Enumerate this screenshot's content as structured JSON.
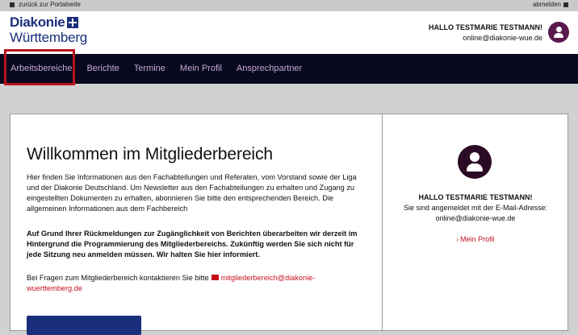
{
  "topbar": {
    "back_label": "zurück zur Portalseite",
    "logout_label": "abmelden"
  },
  "header": {
    "brand_line1": "Diakonie",
    "brand_line2": "Württemberg",
    "user_greeting": "HALLO TESTMARIE TESTMANN!",
    "user_email": "online@diakonie-wue.de"
  },
  "nav": {
    "items": [
      {
        "label": "Arbeitsbereiche"
      },
      {
        "label": "Berichte"
      },
      {
        "label": "Termine"
      },
      {
        "label": "Mein Profil"
      },
      {
        "label": "Ansprechpartner"
      }
    ]
  },
  "main": {
    "title": "Willkommen im Mitgliederbereich",
    "intro": "Hier finden Sie Informationen aus den Fachabteilungen und Referaten, vom Vorstand sowie der Liga und der Diakonie Deutschland. Um Newsletter aus den Fachabteilungen zu erhalten und Zugang zu eingestellten Dokumenten zu erhalten, abonnieren Sie bitte den entsprechenden Bereich. Die allgemeinen Informationen aus dem Fachbereich",
    "notice": "Auf Grund Ihrer Rückmeldungen zur Zugänglichkeit von Berichten überarbeiten wir derzeit im Hintergrund die Programmierung des Mitgliederbereichs. Zukünftig werden Sie sich nicht für jede Sitzung neu anmelden müssen. Wir halten Sie hier informiert.",
    "contact_prefix": "Bei Fragen zum Mitgliederbereich kontaktieren Sie bitte",
    "contact_email": "mitgliederbereich@diakonie-wuerttemberg.de"
  },
  "side": {
    "greeting": "HALLO TESTMARIE TESTMANN!",
    "logged_in_text": "Sie sind angemeldet mit der E-Mail-Adresse:",
    "email": "online@diakonie-wue.de",
    "profile_link": "Mein Profil"
  },
  "colors": {
    "brand_blue": "#1a2f7c",
    "nav_bg": "#070a1c",
    "nav_text": "#c7a6d9",
    "link_red": "#c5121d",
    "avatar_purple": "#5a1a4e",
    "highlight_red": "#b7141e"
  },
  "icons": {
    "back": "square-icon",
    "logout": "logout-icon",
    "logo": "diakonie-cross-icon",
    "user": "user-avatar-icon",
    "mail": "envelope-icon",
    "chevron": "chevron-right-icon"
  }
}
